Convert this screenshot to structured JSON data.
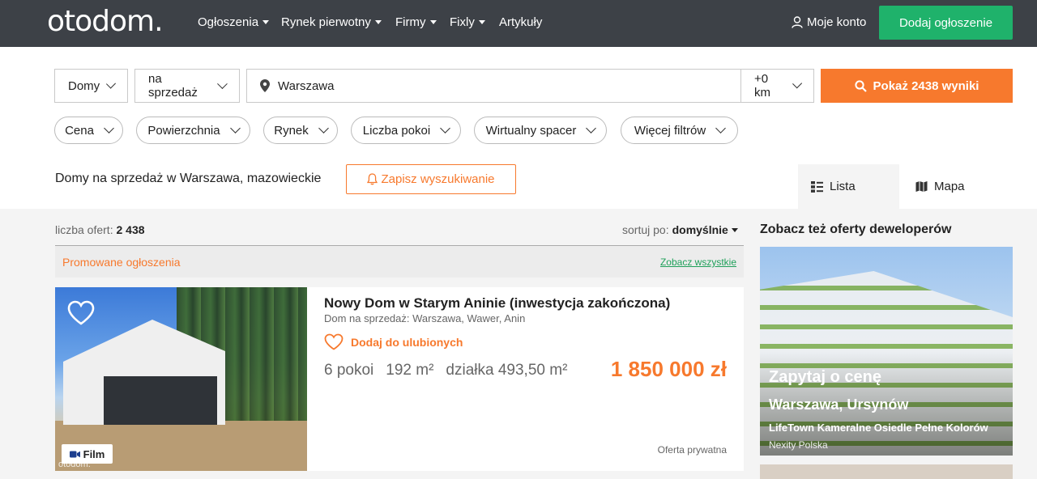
{
  "header": {
    "logo": "otodom.",
    "nav": [
      {
        "label": "Ogłoszenia",
        "has_caret": true
      },
      {
        "label": "Rynek pierwotny",
        "has_caret": true
      },
      {
        "label": "Firmy",
        "has_caret": true
      },
      {
        "label": "Fixly",
        "has_caret": true
      },
      {
        "label": "Artykuły",
        "has_caret": false
      }
    ],
    "account_label": "Moje konto",
    "add_button": "Dodaj ogłoszenie",
    "icons": {
      "account": "user-icon"
    }
  },
  "search": {
    "property_type": "Domy",
    "transaction": "na sprzedaż",
    "location": "Warszawa",
    "radius": "+0 km",
    "search_button": "Pokaż 2438 wyniki",
    "filters": [
      "Cena",
      "Powierzchnia",
      "Rynek",
      "Liczba pokoi",
      "Wirtualny spacer",
      "Więcej filtrów"
    ]
  },
  "results": {
    "heading": "Domy na sprzedaż w Warszawa, mazowieckie",
    "save_button": "Zapisz wyszukiwanie",
    "view_tabs": {
      "list": "Lista",
      "map": "Mapa",
      "active": "list"
    },
    "count_label": "liczba ofert:",
    "count_value": "2 438",
    "sort_label": "sortuj po:",
    "sort_value": "domyślnie",
    "promoted_title": "Promowane ogłoszenia",
    "see_all": "Zobacz wszystkie"
  },
  "listing": {
    "title": "Nowy Dom w Starym Aninie (inwestycja zakończona)",
    "subtitle": "Dom na sprzedaż: Warszawa, Wawer, Anin",
    "favorite": "Dodaj do ulubionych",
    "rooms": "6 pokoi",
    "area": "192 m²",
    "plot": "działka 493,50 m²",
    "price": "1 850 000 zł",
    "seller": "Oferta prywatna",
    "film_badge": "Film",
    "watermark": "otodom."
  },
  "developers": {
    "title": "Zobacz też oferty deweloperów",
    "card": {
      "headline": "Zapytaj o cenę",
      "location": "Warszawa, Ursynów",
      "name": "LifeTown Kameralne Osiedle Pełne Kolorów",
      "company": "Nexity Polska"
    }
  },
  "colors": {
    "nav_bg": "#3d4147",
    "green": "#1fb26b",
    "orange": "#f7792d",
    "link_green": "#1fa05a"
  }
}
